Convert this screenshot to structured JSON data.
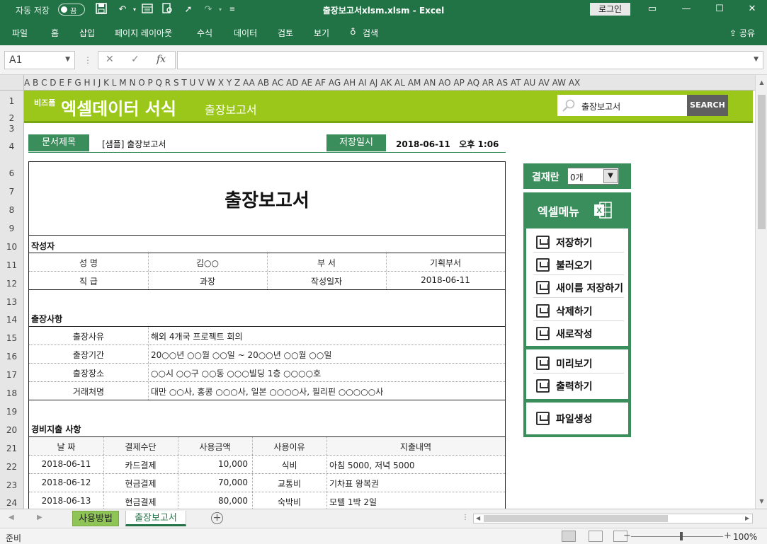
{
  "titlebar": {
    "autosave_label": "자동 저장",
    "autosave_state": "끔",
    "doc_title": "출장보고서xlsm.xlsm  -  Excel",
    "login": "로그인"
  },
  "ribbon": {
    "tabs": [
      "파일",
      "홈",
      "삽입",
      "페이지 레이아웃",
      "수식",
      "데이터",
      "검토",
      "보기",
      "검색"
    ],
    "share": "공유"
  },
  "formula_bar": {
    "cell_ref": "A1",
    "fx": "fx",
    "value": ""
  },
  "columns": "A B C D E F G H I J K L M N O P Q R S T U V W X Y Z AA AB AC AD AE AF AG AH AI AJ AK AL AM AN AO AP AQ AR AS AT AU AV AW AX",
  "rows": [
    "1",
    "2",
    "3",
    "4",
    "6",
    "7",
    "8",
    "9",
    "10",
    "11",
    "12",
    "13",
    "14",
    "15",
    "16",
    "17",
    "18",
    "19",
    "20",
    "21",
    "22",
    "23",
    "24"
  ],
  "banner": {
    "logo_small": "비즈폼",
    "logo_big": "엑셀데이터 서식",
    "subtitle": "출장보고서",
    "search_value": "출장보고서",
    "search_button": "SEARCH"
  },
  "header": {
    "doc_title_label": "문서제목",
    "doc_title_value": "[샘플] 출장보고서",
    "saved_label": "저장일시",
    "saved_value": "2018-06-11   오후 1:06"
  },
  "report": {
    "title": "출장보고서",
    "author_section": "작성자",
    "author": {
      "name_label": "성  명",
      "name_value": "김○○",
      "dept_label": "부  서",
      "dept_value": "기획부서",
      "rank_label": "직  급",
      "rank_value": "과장",
      "date_label": "작성일자",
      "date_value": "2018-06-11"
    },
    "trip_section": "출장사항",
    "trip": [
      {
        "label": "출장사유",
        "value": "해외 4개국 프로젝트 회의"
      },
      {
        "label": "출장기간",
        "value": "20○○년 ○○월 ○○일 ~ 20○○년 ○○월 ○○일"
      },
      {
        "label": "출장장소",
        "value": "○○시 ○○구 ○○동 ○○○빌딩 1층 ○○○○호"
      },
      {
        "label": "거래처명",
        "value": "대만 ○○사, 홍콩 ○○○사, 일본 ○○○○사, 필리핀 ○○○○○사"
      }
    ],
    "expense_section": "경비지출 사항",
    "expense_headers": [
      "날  짜",
      "결제수단",
      "사용금액",
      "사용이유",
      "지출내역"
    ],
    "expenses": [
      {
        "date": "2018-06-11",
        "method": "카드결제",
        "amount": "10,000",
        "reason": "식비",
        "detail": "아침 5000, 저녁 5000"
      },
      {
        "date": "2018-06-12",
        "method": "현금결제",
        "amount": "70,000",
        "reason": "교통비",
        "detail": "기차표 왕복권"
      },
      {
        "date": "2018-06-13",
        "method": "현금결제",
        "amount": "80,000",
        "reason": "숙박비",
        "detail": "모텔 1박 2일"
      }
    ]
  },
  "approval": {
    "label": "결재란",
    "value": "0개"
  },
  "menu": {
    "title": "엑셀메뉴",
    "group1": [
      "저장하기",
      "불러오기",
      "새이름 저장하기",
      "삭제하기",
      "새로작성"
    ],
    "group2": [
      "미리보기",
      "출력하기"
    ],
    "group3": [
      "파일생성"
    ]
  },
  "sheet_tabs": [
    "사용방법",
    "출장보고서"
  ],
  "status": {
    "ready": "준비",
    "zoom": "100%"
  },
  "colors": {
    "excel_green": "#217346",
    "banner_green": "#9bc71a",
    "label_green": "#3a8e5c"
  }
}
